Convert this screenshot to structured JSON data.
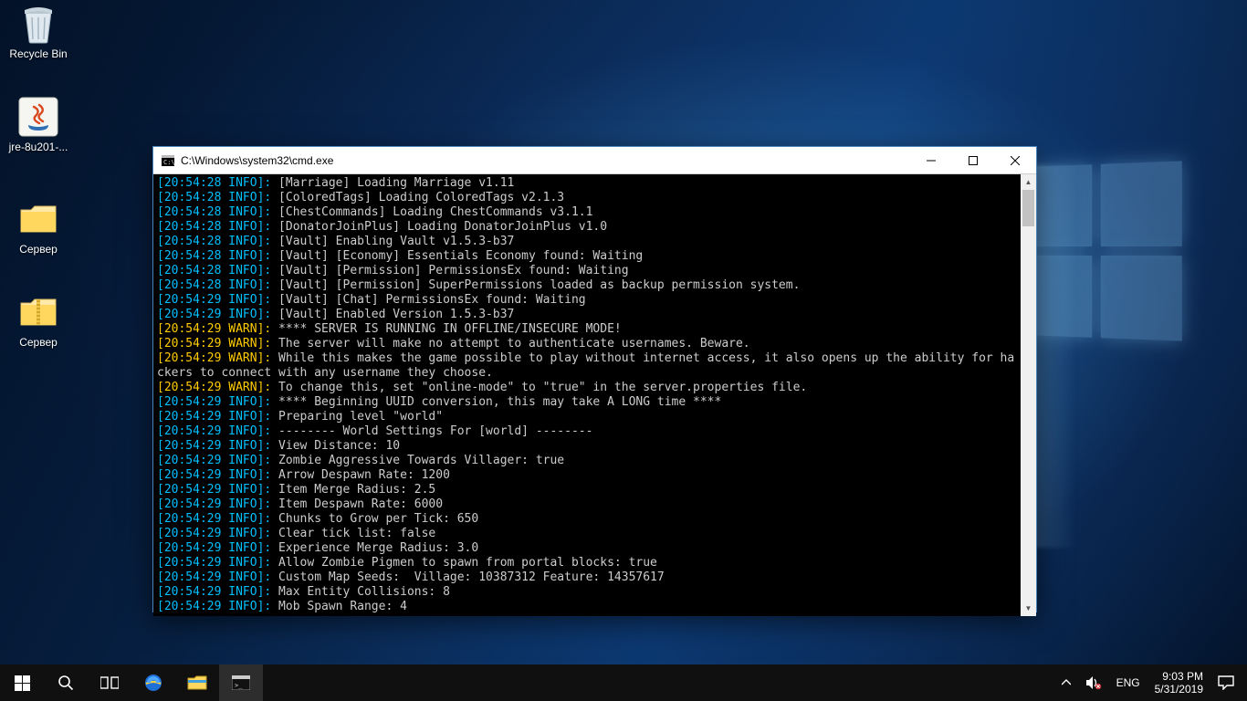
{
  "desktop": {
    "recycle_label": "Recycle Bin",
    "jre_label": "jre-8u201-...",
    "folder1_label": "Сервер",
    "folder2_label": "Сервер"
  },
  "cmd": {
    "title": "C:\\Windows\\system32\\cmd.exe",
    "lines": [
      {
        "level": "INFO",
        "ts": "[20:54:28 INFO]:",
        "text": " [Marriage] Loading Marriage v1.11"
      },
      {
        "level": "INFO",
        "ts": "[20:54:28 INFO]:",
        "text": " [ColoredTags] Loading ColoredTags v2.1.3"
      },
      {
        "level": "INFO",
        "ts": "[20:54:28 INFO]:",
        "text": " [ChestCommands] Loading ChestCommands v3.1.1"
      },
      {
        "level": "INFO",
        "ts": "[20:54:28 INFO]:",
        "text": " [DonatorJoinPlus] Loading DonatorJoinPlus v1.0"
      },
      {
        "level": "INFO",
        "ts": "[20:54:28 INFO]:",
        "text": " [Vault] Enabling Vault v1.5.3-b37"
      },
      {
        "level": "INFO",
        "ts": "[20:54:28 INFO]:",
        "text": " [Vault] [Economy] Essentials Economy found: Waiting"
      },
      {
        "level": "INFO",
        "ts": "[20:54:28 INFO]:",
        "text": " [Vault] [Permission] PermissionsEx found: Waiting"
      },
      {
        "level": "INFO",
        "ts": "[20:54:28 INFO]:",
        "text": " [Vault] [Permission] SuperPermissions loaded as backup permission system."
      },
      {
        "level": "INFO",
        "ts": "[20:54:29 INFO]:",
        "text": " [Vault] [Chat] PermissionsEx found: Waiting"
      },
      {
        "level": "INFO",
        "ts": "[20:54:29 INFO]:",
        "text": " [Vault] Enabled Version 1.5.3-b37"
      },
      {
        "level": "WARN",
        "ts": "[20:54:29 WARN]:",
        "text": " **** SERVER IS RUNNING IN OFFLINE/INSECURE MODE!"
      },
      {
        "level": "WARN",
        "ts": "[20:54:29 WARN]:",
        "text": " The server will make no attempt to authenticate usernames. Beware."
      },
      {
        "level": "WARN",
        "ts": "[20:54:29 WARN]:",
        "text": " While this makes the game possible to play without internet access, it also opens up the ability for ha"
      },
      {
        "level": "CONT",
        "ts": "",
        "text": "ckers to connect with any username they choose."
      },
      {
        "level": "WARN",
        "ts": "[20:54:29 WARN]:",
        "text": " To change this, set \"online-mode\" to \"true\" in the server.properties file."
      },
      {
        "level": "INFO",
        "ts": "[20:54:29 INFO]:",
        "text": " **** Beginning UUID conversion, this may take A LONG time ****"
      },
      {
        "level": "INFO",
        "ts": "[20:54:29 INFO]:",
        "text": " Preparing level \"world\""
      },
      {
        "level": "INFO",
        "ts": "[20:54:29 INFO]:",
        "text": " -------- World Settings For [world] --------"
      },
      {
        "level": "INFO",
        "ts": "[20:54:29 INFO]:",
        "text": " View Distance: 10"
      },
      {
        "level": "INFO",
        "ts": "[20:54:29 INFO]:",
        "text": " Zombie Aggressive Towards Villager: true"
      },
      {
        "level": "INFO",
        "ts": "[20:54:29 INFO]:",
        "text": " Arrow Despawn Rate: 1200"
      },
      {
        "level": "INFO",
        "ts": "[20:54:29 INFO]:",
        "text": " Item Merge Radius: 2.5"
      },
      {
        "level": "INFO",
        "ts": "[20:54:29 INFO]:",
        "text": " Item Despawn Rate: 6000"
      },
      {
        "level": "INFO",
        "ts": "[20:54:29 INFO]:",
        "text": " Chunks to Grow per Tick: 650"
      },
      {
        "level": "INFO",
        "ts": "[20:54:29 INFO]:",
        "text": " Clear tick list: false"
      },
      {
        "level": "INFO",
        "ts": "[20:54:29 INFO]:",
        "text": " Experience Merge Radius: 3.0"
      },
      {
        "level": "INFO",
        "ts": "[20:54:29 INFO]:",
        "text": " Allow Zombie Pigmen to spawn from portal blocks: true"
      },
      {
        "level": "INFO",
        "ts": "[20:54:29 INFO]:",
        "text": " Custom Map Seeds:  Village: 10387312 Feature: 14357617"
      },
      {
        "level": "INFO",
        "ts": "[20:54:29 INFO]:",
        "text": " Max Entity Collisions: 8"
      },
      {
        "level": "INFO",
        "ts": "[20:54:29 INFO]:",
        "text": " Mob Spawn Range: 4"
      }
    ]
  },
  "taskbar": {
    "lang": "ENG",
    "time": "9:03 PM",
    "date": "5/31/2019"
  }
}
